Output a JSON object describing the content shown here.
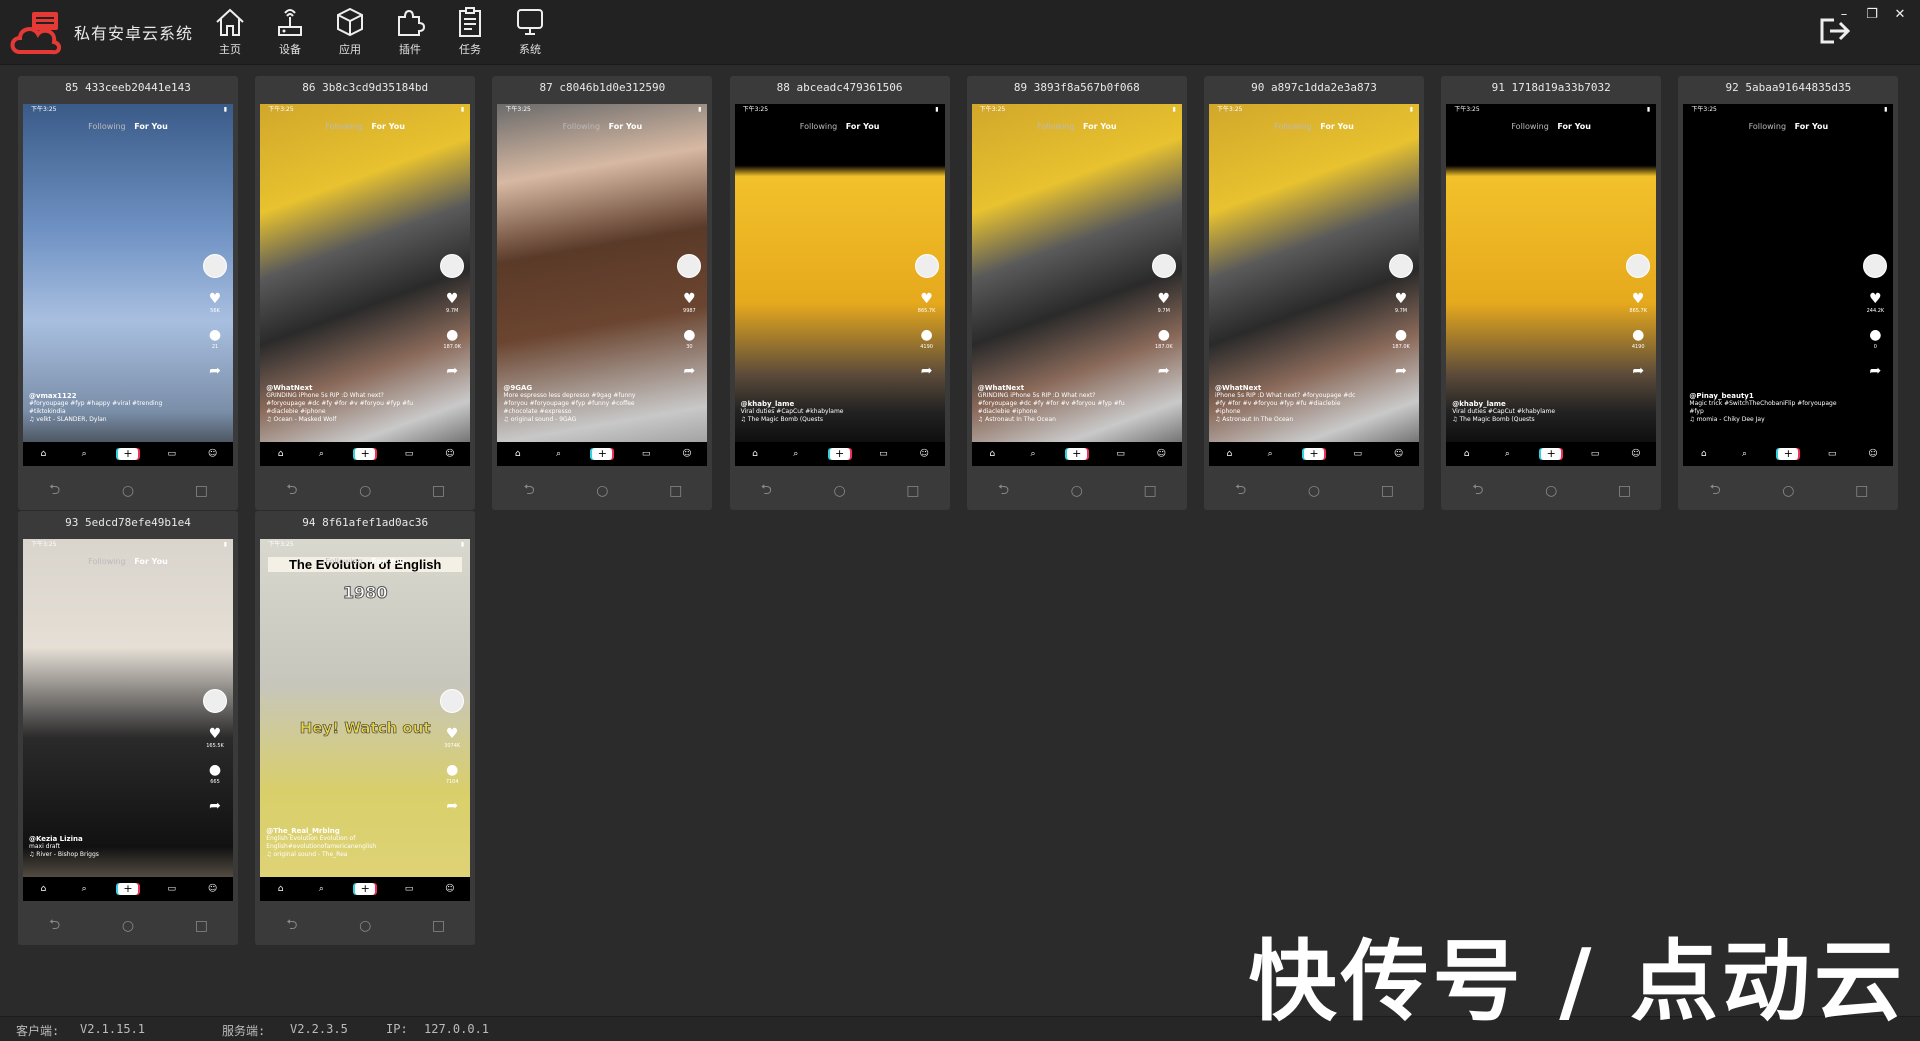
{
  "app": {
    "title": "私有安卓云系统"
  },
  "nav": [
    {
      "label": "主页",
      "icon": "home-icon"
    },
    {
      "label": "设备",
      "icon": "device-icon"
    },
    {
      "label": "应用",
      "icon": "app-cube-icon"
    },
    {
      "label": "插件",
      "icon": "plugin-puzzle-icon"
    },
    {
      "label": "任务",
      "icon": "task-clipboard-icon"
    },
    {
      "label": "系统",
      "icon": "monitor-icon"
    }
  ],
  "window_controls": {
    "minimize": "–",
    "restore": "❐",
    "close": "✕"
  },
  "phone_common": {
    "time": "下午3:25",
    "feed_following": "Following",
    "feed_foryou": "For You",
    "tabs": [
      "Home",
      "Discover",
      "+",
      "Inbox",
      "Profile"
    ],
    "nav_back": "⮌",
    "nav_home": "○",
    "nav_recent": "□"
  },
  "devices": [
    {
      "title": "85 433ceeb20441e143",
      "user": "@vmax1122",
      "text": "#foryoupage #fyp #happy #viral #trending #tiktokindia",
      "sound": "velkt - SLANDER, Dylan",
      "bg": "sky",
      "likes": "56K",
      "comments": "21"
    },
    {
      "title": "86 3b8c3cd9d35184bd",
      "user": "@WhatNext",
      "text": "GRINDING iPhone 5s RIP :D What next? #foryoupage #dc #fy #for #v #foryou #fyp #fu #diaclebie #iphone",
      "sound": "Ocean - Masked Wolf",
      "bg": "grinder",
      "likes": "9.7M",
      "comments": "187.0K"
    },
    {
      "title": "87 c8046b1d0e312590",
      "user": "@9GAG",
      "text": "More espresso less depresso #9gag #funny #foryou #foryoupage #fyp #funny #coffee #chocolate #expresso",
      "sound": "original sound - 9GAG",
      "bg": "chocolate",
      "likes": "9987",
      "comments": "30"
    },
    {
      "title": "88 abceadc479361506",
      "user": "@khaby_lame",
      "text": "Viral duties #CapCut #khabylame",
      "sound": "The Magic Bomb (Quests",
      "bg": "slipper",
      "likes": "865.7K",
      "comments": "4190"
    },
    {
      "title": "89 3893f8a567b0f068",
      "user": "@WhatNext",
      "text": "GRINDING iPhone 5s RIP :D What next? #foryoupage #dc #fy #for #v #foryou #fyp #fu #diaclebie #iphone",
      "sound": "Astronaut In The Ocean",
      "bg": "grinder",
      "likes": "9.7M",
      "comments": "187.0K"
    },
    {
      "title": "90 a897c1dda2e3a873",
      "user": "@WhatNext",
      "text": "iPhone 5s RIP :D What next? #foryoupage #dc #fy #for #v #foryou #fyp #fu #diaclebie #iphone",
      "sound": "Astronaut In The Ocean",
      "bg": "grinder",
      "likes": "9.7M",
      "comments": "187.0K"
    },
    {
      "title": "91 1718d19a33b7032",
      "user": "@khaby_lame",
      "text": "Viral duties #CapCut #khabylame",
      "sound": "The Magic Bomb (Quests",
      "bg": "slipper",
      "likes": "865.7K",
      "comments": "4190"
    },
    {
      "title": "92 5abaa91644835d35",
      "user": "@Pinay_beauty1",
      "text": "Magic trick #SwitchTheChobaniFlip #foryoupage #fyp",
      "sound": "momia - Chiky Dee Jay",
      "bg": "black",
      "likes": "244.2K",
      "comments": "0"
    },
    {
      "title": "93 5edcd78efe49b1e4",
      "user": "@Kezia Lizina",
      "text": "maxi draft",
      "sound": "River - Bishop Briggs",
      "bg": "portrait",
      "likes": "165.5K",
      "comments": "665"
    },
    {
      "title": "94 8f61afef1ad0ac36",
      "user": "@The_Real_Mrblng",
      "text": "English Evolution Evolution of English#evolutionofamericanenglish",
      "sound": "original sound - The_Rea",
      "bg": "english",
      "likes": "3074K",
      "comments": "7104",
      "overlay_title": "The Evolution of English",
      "overlay_year": "1980",
      "overlay_hey": "Hey!  Watch out"
    }
  ],
  "footer": {
    "client_label": "客户端:",
    "client_version": "V2.1.15.1",
    "server_label": "服务端:",
    "server_version": "V2.2.3.5",
    "ip_label": "IP:",
    "ip_value": "127.0.0.1"
  },
  "watermark": "快传号 / 点动云"
}
